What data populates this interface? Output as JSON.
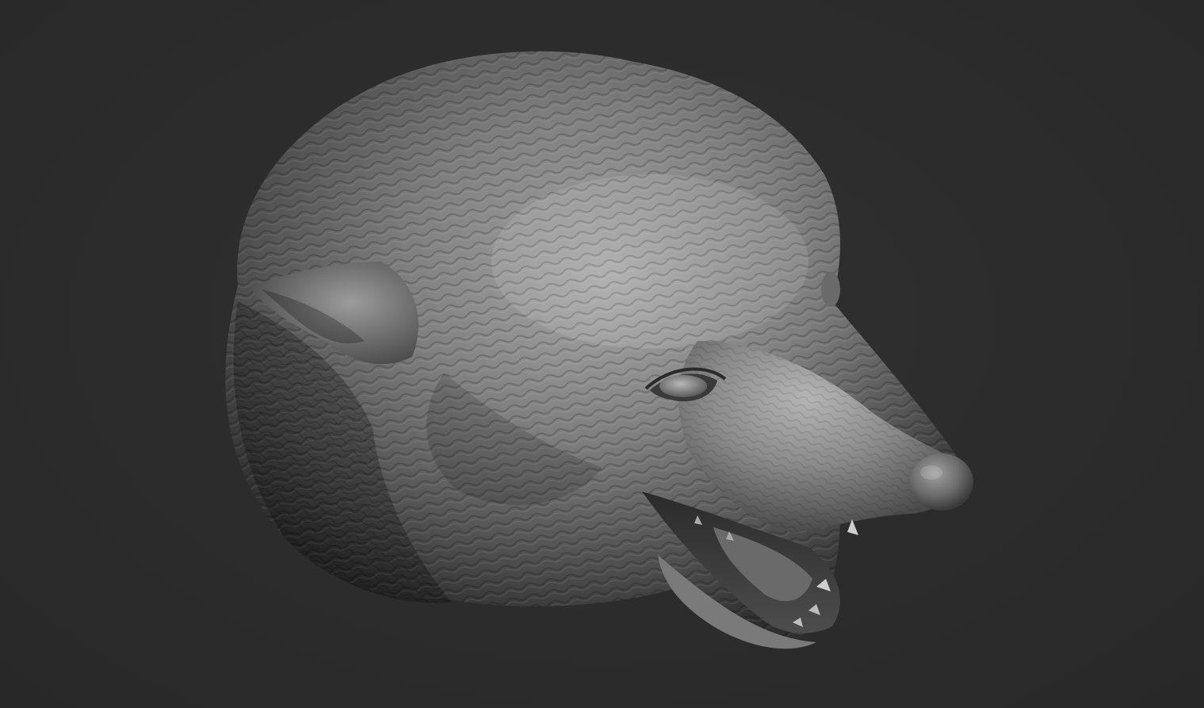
{
  "scene": {
    "subject": "wolf-head-sculpt",
    "background_color": "#2b2b2b",
    "material_color": "#8c8c8c",
    "highlight_color": "#d9d9d9",
    "shadow_color": "#1a1a1a",
    "subject_icon": "wolf-head-icon"
  }
}
